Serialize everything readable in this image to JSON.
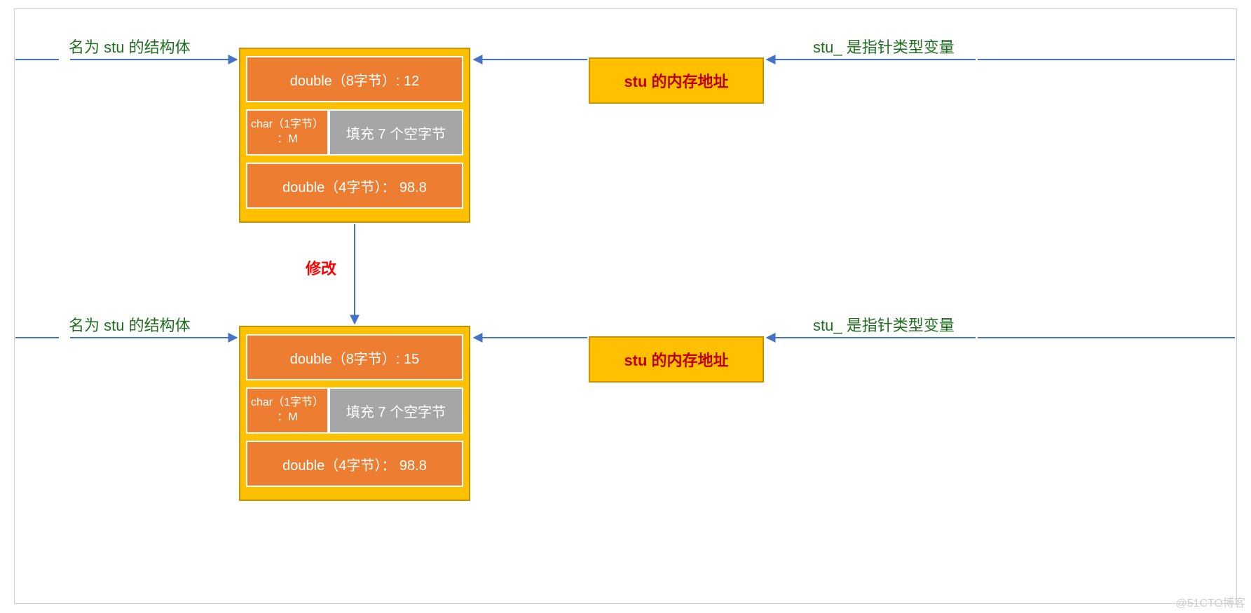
{
  "labels": {
    "struct_title_1": "名为 stu 的结构体",
    "struct_title_2": "名为 stu 的结构体",
    "pointer_title_1": "stu_ 是指针类型变量",
    "pointer_title_2": "stu_ 是指针类型变量",
    "modify": "修改"
  },
  "struct1": {
    "row1": "double（8字节）: 12",
    "char_line1": "char（1字节）",
    "char_line2": "：M",
    "pad": "填充 7 个空字节",
    "row3": "double（4字节）： 98.8"
  },
  "struct2": {
    "row1": "double（8字节）: 15",
    "char_line1": "char（1字节）",
    "char_line2": "：M",
    "pad": "填充 7 个空字节",
    "row3": "double（4字节）： 98.8"
  },
  "addr": {
    "text": "stu 的内存地址"
  },
  "watermark": "@51CTO博客",
  "colors": {
    "frame_border": "#d0d0d0",
    "label_green": "#1f6f1f",
    "box_fill": "#ffc000",
    "box_border": "#c59300",
    "field_fill": "#ed7d31",
    "pad_fill": "#a6a6a6",
    "arrow_blue": "#4472c4",
    "red": "#ff0000",
    "addr_text": "#c00000"
  }
}
